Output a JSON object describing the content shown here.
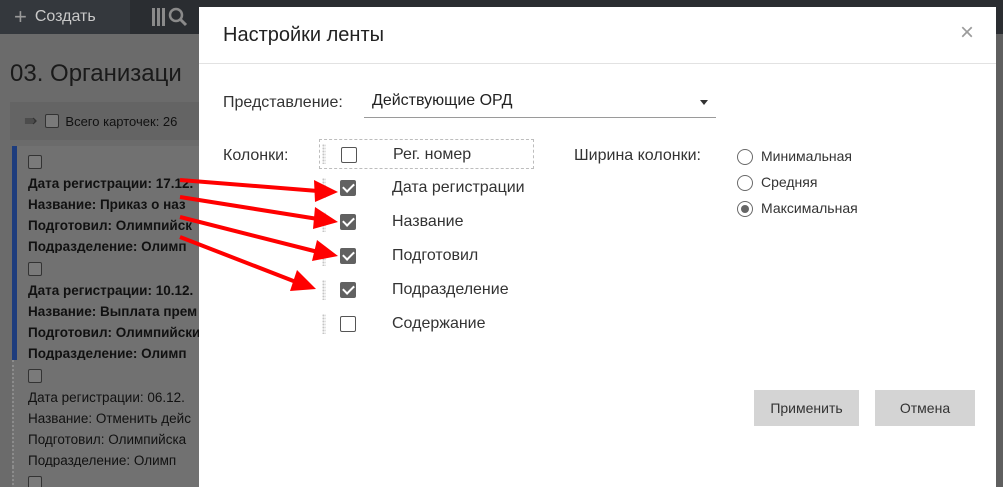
{
  "app": {
    "create_label": "Создать",
    "page_title": "03. Организаци",
    "toolbar_total": "Всего карточек: 26"
  },
  "cards": [
    {
      "lines": [
        "Дата регистрации: 17.12.",
        "Название: Приказ о наз",
        "Подготовил: Олимпийск",
        "Подразделение: Олимп"
      ],
      "bold": true
    },
    {
      "lines": [
        "Дата регистрации: 10.12.",
        "Название: Выплата прем",
        "Подготовил: Олимпийски",
        "Подразделение: Олимп"
      ],
      "bold": true
    },
    {
      "lines": [
        "Дата регистрации: 06.12.",
        "Название: Отменить дейс",
        "Подготовил: Олимпийска",
        "Подразделение: Олимп"
      ],
      "bold": false
    }
  ],
  "dialog": {
    "title": "Настройки ленты",
    "close_glyph": "×",
    "view_label": "Представление:",
    "view_value": "Действующие ОРД",
    "columns_label": "Колонки:",
    "columns": [
      {
        "label": "Рег. номер",
        "checked": false
      },
      {
        "label": "Дата регистрации",
        "checked": true
      },
      {
        "label": "Название",
        "checked": true
      },
      {
        "label": "Подготовил",
        "checked": true
      },
      {
        "label": "Подразделение",
        "checked": true
      },
      {
        "label": "Содержание",
        "checked": false
      }
    ],
    "width_label": "Ширина колонки:",
    "widths": [
      {
        "label": "Минимальная",
        "selected": false
      },
      {
        "label": "Средняя",
        "selected": false
      },
      {
        "label": "Максимальная",
        "selected": true
      }
    ],
    "apply_label": "Применить",
    "cancel_label": "Отмена"
  },
  "colors": {
    "arrow": "#ff0000",
    "card_accent": "#1d3c7d",
    "button_bg": "#d4d4d4"
  }
}
